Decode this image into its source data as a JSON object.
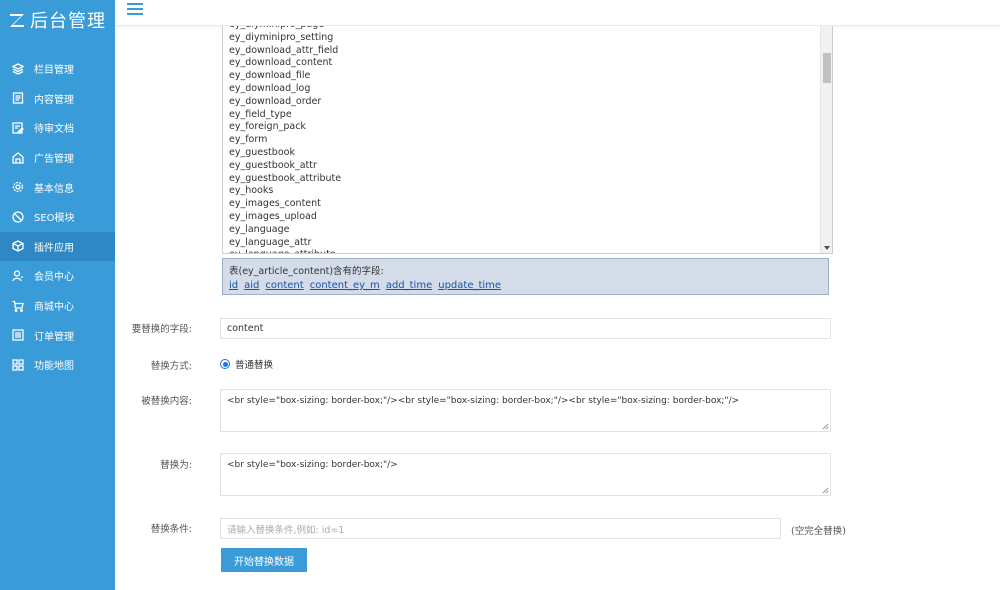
{
  "app": {
    "logo_text": "后台管理"
  },
  "sidebar": {
    "items": [
      {
        "label": "栏目管理",
        "icon": "layers-icon"
      },
      {
        "label": "内容管理",
        "icon": "document-icon"
      },
      {
        "label": "待审文档",
        "icon": "pending-doc-icon"
      },
      {
        "label": "广告管理",
        "icon": "ad-icon"
      },
      {
        "label": "基本信息",
        "icon": "gear-icon"
      },
      {
        "label": "SEO模块",
        "icon": "seo-icon"
      },
      {
        "label": "插件应用",
        "icon": "plugin-cube-icon",
        "active": true
      },
      {
        "label": "会员中心",
        "icon": "user-icon"
      },
      {
        "label": "商城中心",
        "icon": "cart-icon"
      },
      {
        "label": "订单管理",
        "icon": "order-list-icon"
      },
      {
        "label": "功能地图",
        "icon": "grid-map-icon"
      }
    ]
  },
  "table_list": {
    "options": [
      "ey_diyminipro_page",
      "ey_diyminipro_setting",
      "ey_download_attr_field",
      "ey_download_content",
      "ey_download_file",
      "ey_download_log",
      "ey_download_order",
      "ey_field_type",
      "ey_foreign_pack",
      "ey_form",
      "ey_guestbook",
      "ey_guestbook_attr",
      "ey_guestbook_attribute",
      "ey_hooks",
      "ey_images_content",
      "ey_images_upload",
      "ey_language",
      "ey_language_attr",
      "ey_language_attribute"
    ]
  },
  "fields_box": {
    "title": "表(ey_article_content)含有的字段:",
    "fields": [
      "id",
      "aid",
      "content",
      "content_ey_m",
      "add_time",
      "update_time"
    ]
  },
  "form": {
    "field_label": "要替换的字段:",
    "field_value": "content",
    "mode_label": "替换方式:",
    "mode_option": "普通替换",
    "search_label": "被替换内容:",
    "search_value": "<br style=\"box-sizing: border-box;\"/><br style=\"box-sizing: border-box;\"/><br style=\"box-sizing: border-box;\"/>",
    "replace_label": "替换为:",
    "replace_value": "<br style=\"box-sizing: border-box;\"/>",
    "condition_label": "替换条件:",
    "condition_placeholder": "请输入替换条件,例如: id=1",
    "condition_hint": "(空完全替换)",
    "submit_label": "开始替换数据"
  }
}
